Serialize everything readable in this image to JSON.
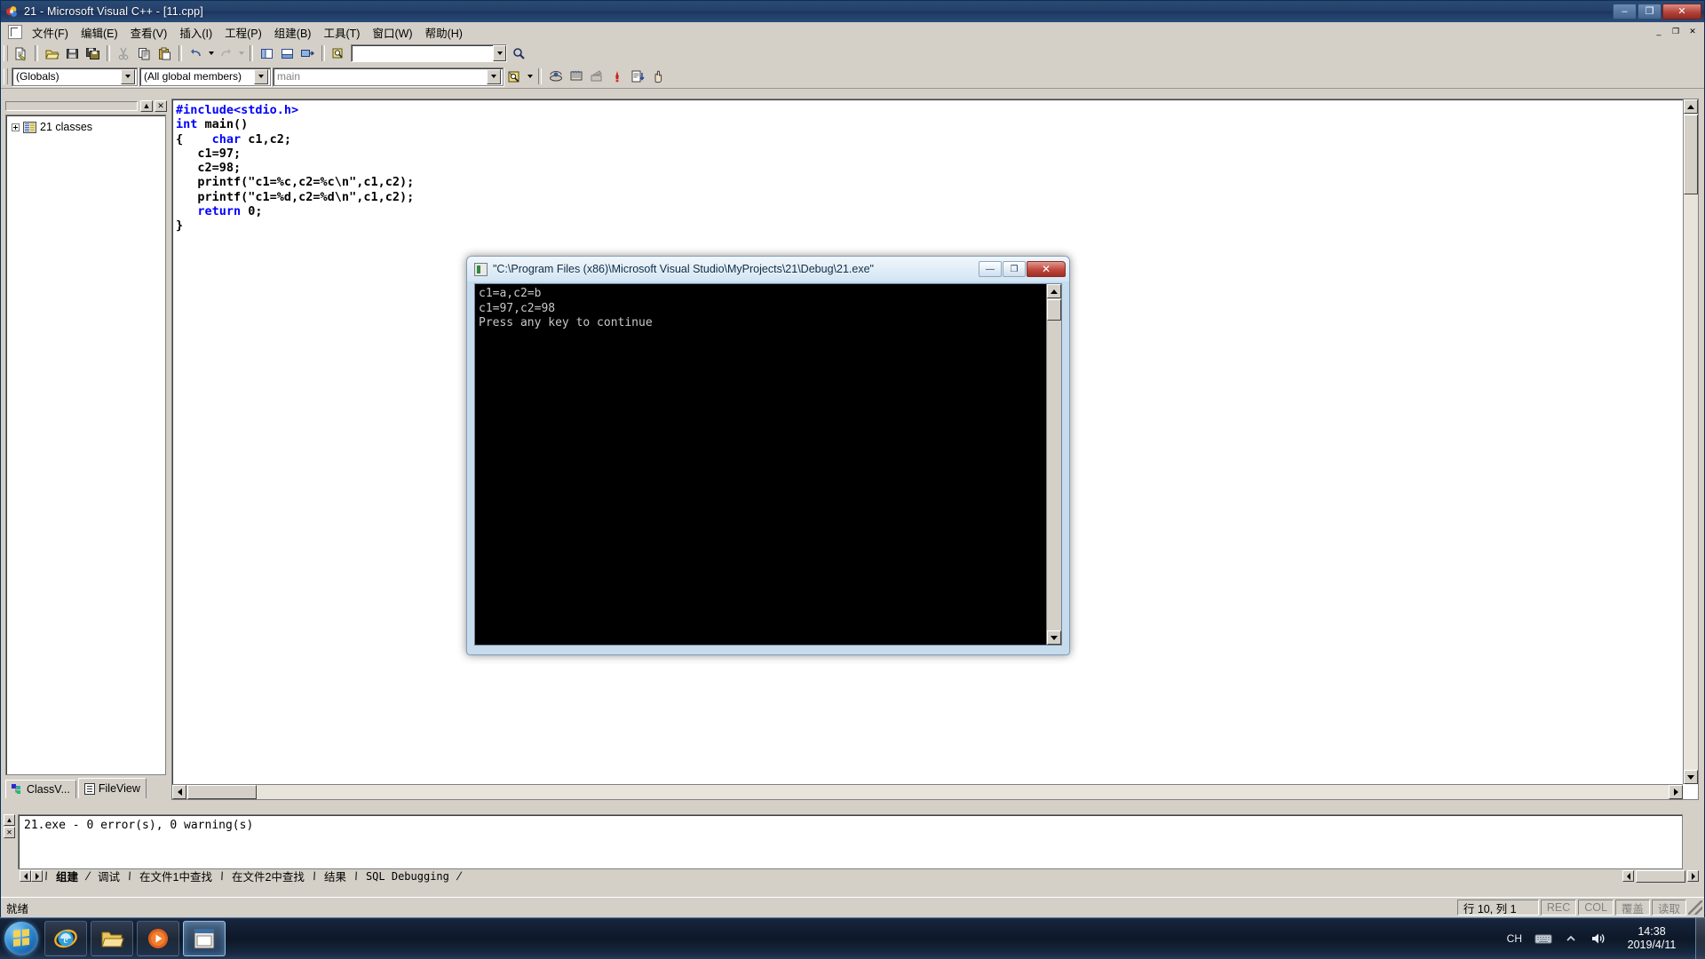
{
  "window": {
    "title": "21 - Microsoft Visual C++ - [11.cpp]",
    "icon": "vcpp-icon",
    "minimize_label": "–",
    "maximize_label": "❐",
    "close_label": "✕"
  },
  "menubar": {
    "doc_icon": "document-icon",
    "items": [
      {
        "label": "文件(F)"
      },
      {
        "label": "编辑(E)"
      },
      {
        "label": "查看(V)"
      },
      {
        "label": "插入(I)"
      },
      {
        "label": "工程(P)"
      },
      {
        "label": "组建(B)"
      },
      {
        "label": "工具(T)"
      },
      {
        "label": "窗口(W)"
      },
      {
        "label": "帮助(H)"
      }
    ],
    "mdi_buttons": [
      {
        "label": "_",
        "name": "mdi-minimize-button"
      },
      {
        "label": "❐",
        "name": "mdi-restore-button"
      },
      {
        "label": "✕",
        "name": "mdi-close-button"
      }
    ]
  },
  "toolbar_standard": {
    "buttons": [
      {
        "name": "new-text-file-icon"
      },
      {
        "name": "open-file-icon"
      },
      {
        "name": "save-icon"
      },
      {
        "name": "save-all-icon"
      },
      {
        "name": "cut-icon"
      },
      {
        "name": "copy-icon"
      },
      {
        "name": "paste-icon"
      },
      {
        "name": "undo-icon"
      },
      {
        "name": "redo-icon"
      },
      {
        "name": "workspace-icon"
      },
      {
        "name": "output-icon"
      },
      {
        "name": "window-list-icon"
      },
      {
        "name": "find-in-files-icon"
      }
    ],
    "find_box_value": "",
    "find_box_placeholder": "",
    "find_button": "find-icon"
  },
  "toolbar_wizardbar": {
    "combo_globals": {
      "value": "(Globals)",
      "name": "globals-combo"
    },
    "combo_members": {
      "value": "(All global members)",
      "name": "members-combo"
    },
    "combo_function": {
      "value": "main",
      "name": "function-combo"
    },
    "action_icon": "wizard-action-icon",
    "buttons": [
      {
        "name": "compile-icon"
      },
      {
        "name": "build-icon"
      },
      {
        "name": "stop-build-icon"
      },
      {
        "name": "execute-program-icon"
      },
      {
        "name": "go-icon"
      },
      {
        "name": "insert-breakpoint-icon"
      }
    ]
  },
  "workspace": {
    "close_button": "✕",
    "collapse_button": "▲",
    "tree": [
      {
        "label": "21 classes",
        "icon": "class-folder-icon",
        "expander": "+"
      }
    ],
    "tabs": [
      {
        "label": "ClassV...",
        "icon": "classview-icon",
        "active": false,
        "name": "tab-classview"
      },
      {
        "label": "FileView",
        "icon": "fileview-icon",
        "active": true,
        "name": "tab-fileview"
      }
    ]
  },
  "editor": {
    "file": "11.cpp",
    "lines": [
      [
        {
          "t": "#include<stdio.h>",
          "c": "pp"
        }
      ],
      [
        {
          "t": "int",
          "c": "kw"
        },
        {
          "t": " main()",
          "c": "plain"
        }
      ],
      [
        {
          "t": "{    ",
          "c": "plain"
        },
        {
          "t": "char",
          "c": "kw"
        },
        {
          "t": " c1,c2;",
          "c": "plain"
        }
      ],
      [
        {
          "t": "   c1=97;",
          "c": "plain"
        }
      ],
      [
        {
          "t": "   c2=98;",
          "c": "plain"
        }
      ],
      [
        {
          "t": "   printf(\"c1=%c,c2=%c\\n\",c1,c2);",
          "c": "plain"
        }
      ],
      [
        {
          "t": "   printf(\"c1=%d,c2=%d\\n\",c1,c2);",
          "c": "plain"
        }
      ],
      [
        {
          "t": "   ",
          "c": "plain"
        },
        {
          "t": "return",
          "c": "kw"
        },
        {
          "t": " 0;",
          "c": "plain"
        }
      ],
      [
        {
          "t": "}",
          "c": "plain"
        }
      ]
    ]
  },
  "output": {
    "text": "21.exe - 0 error(s), 0 warning(s)",
    "tabs": [
      {
        "label": "组建",
        "active": true,
        "name": "output-tab-build"
      },
      {
        "label": "调试",
        "active": false,
        "name": "output-tab-debug"
      },
      {
        "label": "在文件1中查找",
        "active": false,
        "name": "output-tab-find1"
      },
      {
        "label": "在文件2中查找",
        "active": false,
        "name": "output-tab-find2"
      },
      {
        "label": "结果",
        "active": false,
        "name": "output-tab-results"
      },
      {
        "label": "SQL Debugging",
        "active": false,
        "name": "output-tab-sql"
      }
    ]
  },
  "statusbar": {
    "message": "就绪",
    "position": "行 10, 列 1",
    "indicators": [
      "REC",
      "COL",
      "覆盖",
      "读取"
    ]
  },
  "console": {
    "title": "\"C:\\Program Files (x86)\\Microsoft Visual Studio\\MyProjects\\21\\Debug\\21.exe\"",
    "icon": "console-icon",
    "minimize_label": "—",
    "maximize_label": "❐",
    "close_label": "✕",
    "lines": [
      "c1=a,c2=b",
      "c1=97,c2=98",
      "Press any key to continue"
    ]
  },
  "taskbar": {
    "start": "start-orb",
    "apps": [
      {
        "name": "taskbar-internet-explorer",
        "icon": "ie-icon",
        "active": false
      },
      {
        "name": "taskbar-file-explorer",
        "icon": "folder-icon",
        "active": false
      },
      {
        "name": "taskbar-media-player",
        "icon": "media-player-icon",
        "active": false
      },
      {
        "name": "taskbar-visual-cpp",
        "icon": "vcpp-icon",
        "active": true
      }
    ],
    "tray": {
      "ime": "CH",
      "keyboard_icon": "keyboard-icon",
      "show_hidden_icon": "chevron-up-icon",
      "volume_icon": "speaker-icon",
      "time": "14:38",
      "date": "2019/4/11"
    }
  },
  "colors": {
    "titlebar": "#24406a",
    "chrome": "#d4d0c8",
    "keyword": "#0000ff",
    "console_bg": "#000000",
    "console_fg": "#c8c8c8",
    "close_red": "#b5433a"
  }
}
